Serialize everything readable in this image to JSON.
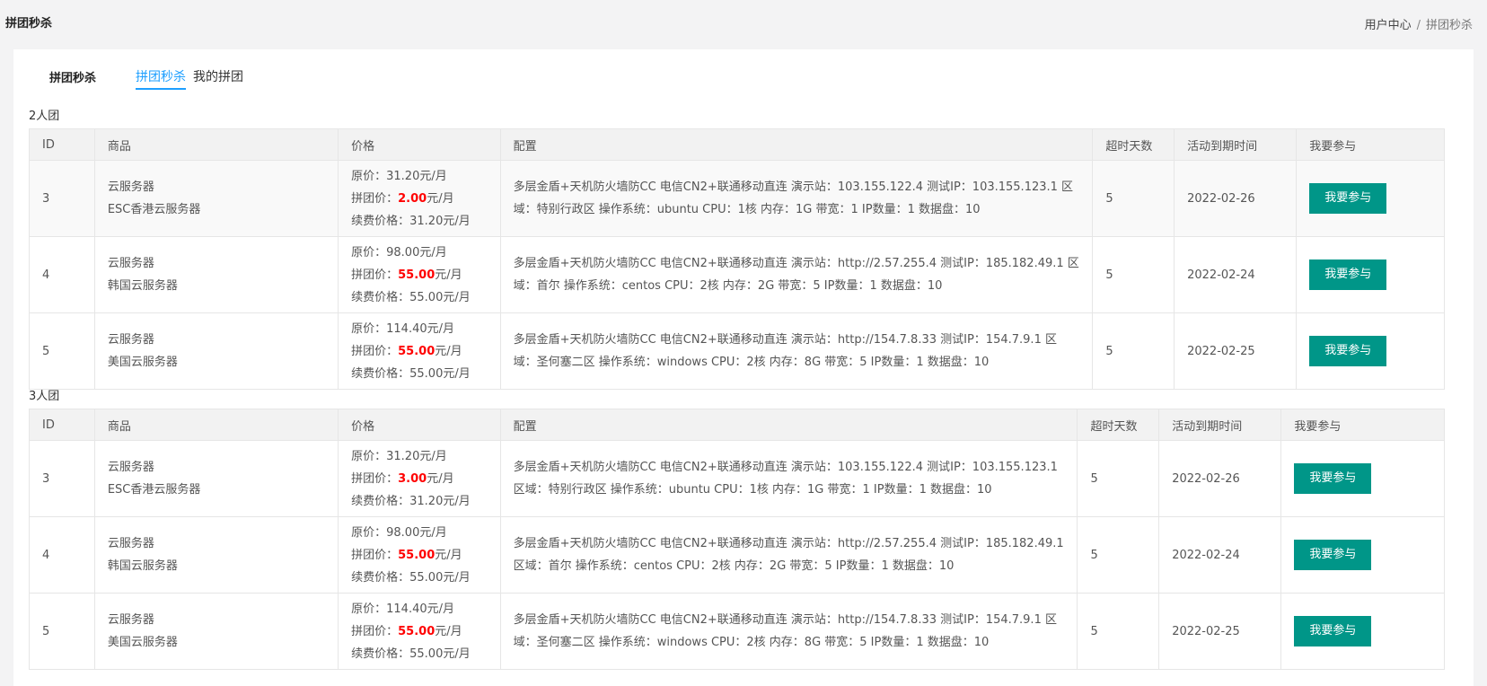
{
  "page": {
    "title": "拼团秒杀"
  },
  "breadcrumb": {
    "home": "用户中心",
    "separator": "/",
    "current": "拼团秒杀"
  },
  "panel": {
    "title": "拼团秒杀",
    "tabs": [
      {
        "label": "拼团秒杀",
        "active": true
      },
      {
        "label": "我的拼团",
        "active": false
      }
    ]
  },
  "labels": {
    "orig_price": "原价：",
    "group_price": "拼团价：",
    "renew_price": "续费价格：",
    "unit": "元/月"
  },
  "headers": {
    "id": "ID",
    "product": "商品",
    "price": "价格",
    "config": "配置",
    "timeout_days": "超时天数",
    "expire": "活动到期时间",
    "join": "我要参与"
  },
  "colors": {
    "accent_tab": "#1e9fff",
    "button": "#009688",
    "price_red": "#ff0000"
  },
  "groups": [
    {
      "title": "2人团",
      "rows": [
        {
          "id": "3",
          "category": "云服务器",
          "name": "ESC香港云服务器",
          "orig_price": "31.20",
          "group_price": "2.00",
          "renew_price": "31.20",
          "config": "多层金盾+天机防火墙防CC 电信CN2+联通移动直连 演示站：103.155.122.4 测试IP：103.155.123.1 区域：特别行政区 操作系统：ubuntu CPU：1核 内存：1G 带宽：1 IP数量：1 数据盘：10",
          "timeout_days": "5",
          "expire": "2022-02-26",
          "button": "我要参与"
        },
        {
          "id": "4",
          "category": "云服务器",
          "name": "韩国云服务器",
          "orig_price": "98.00",
          "group_price": "55.00",
          "renew_price": "55.00",
          "config": "多层金盾+天机防火墙防CC 电信CN2+联通移动直连 演示站：http://2.57.255.4 测试IP：185.182.49.1 区域：首尔 操作系统：centos CPU：2核 内存：2G 带宽：5 IP数量：1 数据盘：10",
          "timeout_days": "5",
          "expire": "2022-02-24",
          "button": "我要参与"
        },
        {
          "id": "5",
          "category": "云服务器",
          "name": "美国云服务器",
          "orig_price": "114.40",
          "group_price": "55.00",
          "renew_price": "55.00",
          "config": "多层金盾+天机防火墙防CC 电信CN2+联通移动直连 演示站：http://154.7.8.33 测试IP：154.7.9.1 区域：圣何塞二区 操作系统：windows CPU：2核 内存：8G 带宽：5 IP数量：1 数据盘：10",
          "timeout_days": "5",
          "expire": "2022-02-25",
          "button": "我要参与"
        }
      ]
    },
    {
      "title": "3人团",
      "rows": [
        {
          "id": "3",
          "category": "云服务器",
          "name": "ESC香港云服务器",
          "orig_price": "31.20",
          "group_price": "3.00",
          "renew_price": "31.20",
          "config": "多层金盾+天机防火墙防CC 电信CN2+联通移动直连 演示站：103.155.122.4 测试IP：103.155.123.1 区域：特别行政区 操作系统：ubuntu CPU：1核 内存：1G 带宽：1 IP数量：1 数据盘：10",
          "timeout_days": "5",
          "expire": "2022-02-26",
          "button": "我要参与"
        },
        {
          "id": "4",
          "category": "云服务器",
          "name": "韩国云服务器",
          "orig_price": "98.00",
          "group_price": "55.00",
          "renew_price": "55.00",
          "config": "多层金盾+天机防火墙防CC 电信CN2+联通移动直连 演示站：http://2.57.255.4 测试IP：185.182.49.1 区域：首尔 操作系统：centos CPU：2核 内存：2G 带宽：5 IP数量：1 数据盘：10",
          "timeout_days": "5",
          "expire": "2022-02-24",
          "button": "我要参与"
        },
        {
          "id": "5",
          "category": "云服务器",
          "name": "美国云服务器",
          "orig_price": "114.40",
          "group_price": "55.00",
          "renew_price": "55.00",
          "config": "多层金盾+天机防火墙防CC 电信CN2+联通移动直连 演示站：http://154.7.8.33 测试IP：154.7.9.1 区域：圣何塞二区 操作系统：windows CPU：2核 内存：8G 带宽：5 IP数量：1 数据盘：10",
          "timeout_days": "5",
          "expire": "2022-02-25",
          "button": "我要参与"
        }
      ]
    }
  ]
}
